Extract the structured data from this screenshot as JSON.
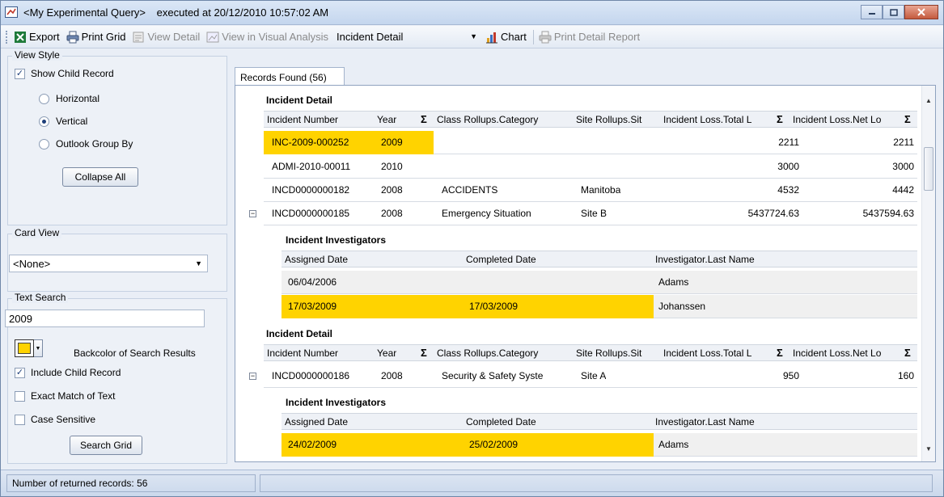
{
  "window": {
    "query_name": "<My Experimental Query>",
    "executed_text": "executed at 20/12/2010 10:57:02 AM"
  },
  "toolbar": {
    "export": "Export",
    "print_grid": "Print Grid",
    "view_detail": "View Detail",
    "view_visual": "View in Visual Analysis",
    "detail_combo": "Incident Detail",
    "chart": "Chart",
    "print_detail": "Print Detail Report"
  },
  "view_style": {
    "title": "View Style",
    "show_child": "Show Child Record",
    "horizontal": "Horizontal",
    "vertical": "Vertical",
    "outlook": "Outlook Group By",
    "collapse_all": "Collapse All"
  },
  "card_view": {
    "title": "Card View",
    "value": "<None>"
  },
  "text_search": {
    "title": "Text Search",
    "value": "2009",
    "backcolor_label": "Backcolor of Search Results",
    "backcolor": "#ffd300",
    "include_child": "Include Child Record",
    "exact_match": "Exact Match of Text",
    "case_sensitive": "Case Sensitive",
    "search_button": "Search Grid"
  },
  "tab": {
    "records_found": "Records Found (56)"
  },
  "grid": {
    "band1_title": "Incident Detail",
    "headers": {
      "incident_number": "Incident Number",
      "year": "Year",
      "category": "Class Rollups.Category",
      "site": "Site Rollups.Sit",
      "total_loss": "Incident Loss.Total L",
      "net_loss": "Incident Loss.Net Lo",
      "sigma": "Σ"
    },
    "rows": [
      {
        "incident": "INC-2009-000252",
        "year": "2009",
        "category": "",
        "site": "",
        "total": "2211",
        "net": "2211"
      },
      {
        "incident": "ADMI-2010-00011",
        "year": "2010",
        "category": "",
        "site": "",
        "total": "3000",
        "net": "3000"
      },
      {
        "incident": "INCD0000000182",
        "year": "2008",
        "category": "ACCIDENTS",
        "site": "Manitoba",
        "total": "4532",
        "net": "4442"
      },
      {
        "incident": "INCD0000000185",
        "year": "2008",
        "category": "Emergency Situation",
        "site": "Site B",
        "total": "5437724.63",
        "net": "5437594.63"
      }
    ],
    "child1": {
      "title": "Incident Investigators",
      "headers": {
        "assigned": "Assigned Date",
        "completed": "Completed Date",
        "investigator": "Investigator.Last Name"
      },
      "rows": [
        {
          "assigned": "06/04/2006",
          "completed": "",
          "investigator": "Adams"
        },
        {
          "assigned": "17/03/2009",
          "completed": "17/03/2009",
          "investigator": "Johanssen"
        }
      ]
    },
    "band2_title": "Incident Detail",
    "row5": {
      "incident": "INCD0000000186",
      "year": "2008",
      "category": "Security & Safety Syste",
      "site": "Site A",
      "total": "950",
      "net": "160"
    },
    "child2": {
      "title": "Incident Investigators",
      "rows": [
        {
          "assigned": "24/02/2009",
          "completed": "25/02/2009",
          "investigator": "Adams"
        }
      ]
    },
    "expand_symbol": "−"
  },
  "status": {
    "text": "Number of returned records: 56"
  }
}
